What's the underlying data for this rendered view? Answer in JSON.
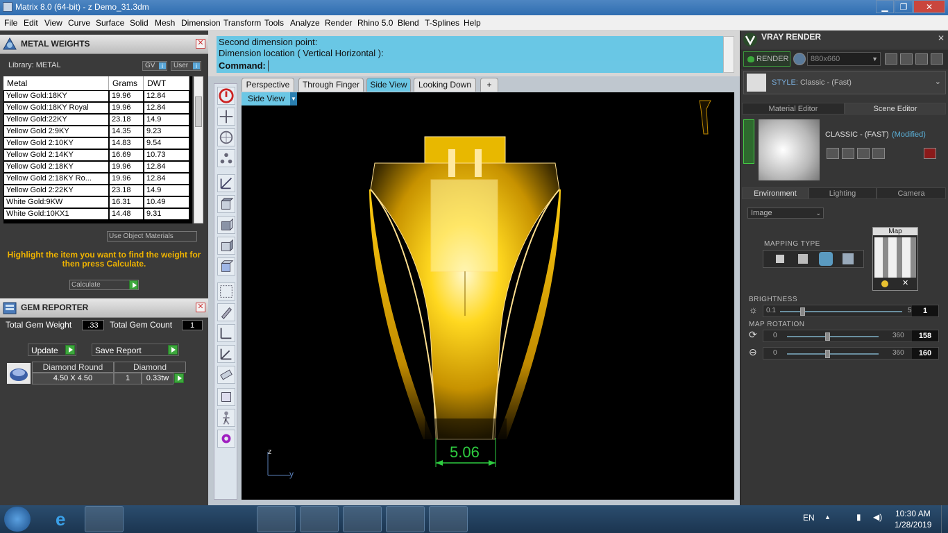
{
  "window": {
    "title": "Matrix 8.0 (64-bit) - z Demo_31.3dm",
    "minimize": "▁",
    "maximize": "❐",
    "close": "✕"
  },
  "menu": [
    "File",
    "Edit",
    "View",
    "Curve",
    "Surface",
    "Solid",
    "Mesh",
    "Dimension",
    "Transform",
    "Tools",
    "Analyze",
    "Render",
    "Rhino 5.0",
    "Blend",
    "T-Splines",
    "Help"
  ],
  "metal_weights": {
    "title": "METAL WEIGHTS",
    "close": "✕",
    "library_label": "Library: METAL",
    "gv": "GV",
    "user": "User",
    "columns": [
      "Metal",
      "Grams",
      "DWT"
    ],
    "rows": [
      [
        "Yellow Gold:18KY",
        "19.96",
        "12.84"
      ],
      [
        "Yellow Gold:18KY Royal",
        "19.96",
        "12.84"
      ],
      [
        "Yellow Gold:22KY",
        "23.18",
        "14.9"
      ],
      [
        "Yellow Gold 2:9KY",
        "14.35",
        "9.23"
      ],
      [
        "Yellow Gold 2:10KY",
        "14.83",
        "9.54"
      ],
      [
        "Yellow Gold 2:14KY",
        "16.69",
        "10.73"
      ],
      [
        "Yellow Gold 2:18KY",
        "19.96",
        "12.84"
      ],
      [
        "Yellow Gold 2:18KY Ro...",
        "19.96",
        "12.84"
      ],
      [
        "Yellow Gold 2:22KY",
        "23.18",
        "14.9"
      ],
      [
        "White Gold:9KW",
        "16.31",
        "10.49"
      ],
      [
        "White Gold:10KX1",
        "14.48",
        "9.31"
      ]
    ],
    "use_object_materials": "Use Object Materials",
    "hint": "Highlight the item you want to find the weight for then press Calculate.",
    "calculate": "Calculate"
  },
  "gem_reporter": {
    "title": "GEM REPORTER",
    "close": "✕",
    "total_weight_label": "Total Gem Weight",
    "total_weight": ".33",
    "total_count_label": "Total Gem Count",
    "total_count": "1",
    "update": "Update",
    "save_report": "Save Report",
    "gem_name": "Diamond Round",
    "gem_type": "Diamond",
    "gem_size": "4.50 X 4.50",
    "gem_qty": "1",
    "gem_weight": "0.33tw"
  },
  "command": {
    "line1": "Second dimension point:",
    "line2": "Dimension location ( Vertical  Horizontal ):",
    "prompt": "Command:"
  },
  "viewport_tabs": [
    "Perspective",
    "Through Finger",
    "Side View",
    "Looking Down",
    "+"
  ],
  "viewport": {
    "label": "Side View",
    "dimension": "5.06",
    "axis_z": "z",
    "axis_y": "y"
  },
  "vray": {
    "title": "VRAY RENDER",
    "close": "✕",
    "render_btn": "RENDER",
    "size": "880x660",
    "style_label": "STYLE:",
    "style_value": "Classic - (Fast)",
    "tabs": [
      "Material Editor",
      "Scene Editor"
    ],
    "scene_name": "CLASSIC - (FAST)",
    "modified": "(Modified)",
    "env_tabs": [
      "Environment",
      "Lighting",
      "Camera"
    ],
    "image_select": "Image",
    "mapping_type": "MAPPING TYPE",
    "map_label": "Map",
    "brightness_label": "BRIGHTNESS",
    "brightness_min": "0.1",
    "brightness_max": "5",
    "brightness": "1",
    "map_rotation_label": "MAP ROTATION",
    "rot_min": "0",
    "rot_max": "360",
    "rot1": "158",
    "rot2": "160",
    "brightness_level": 0.18,
    "rot1_level": 0.44,
    "rot2_level": 0.44
  },
  "taskbar": {
    "lang": "EN",
    "time": "10:30 AM",
    "date": "1/28/2019"
  },
  "colors": {
    "accent": "#6bc7e5",
    "gold": "#f0b400",
    "dim_green": "#2ecc40"
  }
}
